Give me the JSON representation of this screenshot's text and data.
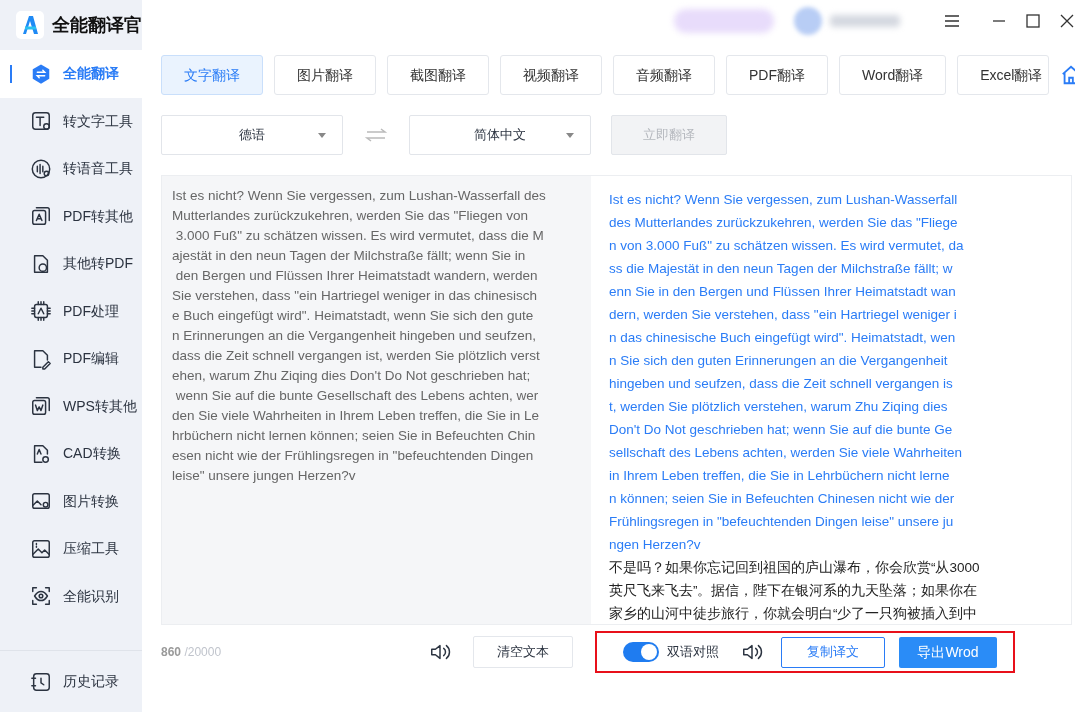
{
  "app": {
    "title": "全能翻译官"
  },
  "sidebar": {
    "items": [
      {
        "label": "全能翻译",
        "selected": true
      },
      {
        "label": "转文字工具",
        "selected": false
      },
      {
        "label": "转语音工具",
        "selected": false
      },
      {
        "label": "PDF转其他",
        "selected": false
      },
      {
        "label": "其他转PDF",
        "selected": false
      },
      {
        "label": "PDF处理",
        "selected": false
      },
      {
        "label": "PDF编辑",
        "selected": false
      },
      {
        "label": "WPS转其他",
        "selected": false
      },
      {
        "label": "CAD转换",
        "selected": false
      },
      {
        "label": "图片转换",
        "selected": false
      },
      {
        "label": "压缩工具",
        "selected": false
      },
      {
        "label": "全能识别",
        "selected": false
      }
    ],
    "footer": {
      "label": "历史记录"
    }
  },
  "tabs": [
    {
      "label": "文字翻译",
      "selected": true
    },
    {
      "label": "图片翻译",
      "selected": false
    },
    {
      "label": "截图翻译",
      "selected": false
    },
    {
      "label": "视频翻译",
      "selected": false
    },
    {
      "label": "音频翻译",
      "selected": false
    },
    {
      "label": "PDF翻译",
      "selected": false
    },
    {
      "label": "Word翻译",
      "selected": false
    },
    {
      "label": "Excel翻译",
      "selected": false
    }
  ],
  "source_language": "德语",
  "target_language": "简体中文",
  "translate_button": {
    "label": "立即翻译",
    "disabled": true
  },
  "source_lines": [
    "Ist es nicht? Wenn Sie vergessen, zum Lushan-Wasserfall des",
    "Mutterlandes zurückzukehren, werden Sie das \"Fliegen von",
    " 3.000 Fuß\" zu schätzen wissen. Es wird vermutet, dass die M",
    "ajestät in den neun Tagen der Milchstraße fällt; wenn Sie in",
    " den Bergen und Flüssen Ihrer Heimatstadt wandern, werden",
    "Sie verstehen, dass \"ein Hartriegel weniger in das chinesisch",
    "e Buch eingefügt wird\". Heimatstadt, wenn Sie sich den gute",
    "n Erinnerungen an die Vergangenheit hingeben und seufzen,",
    "dass die Zeit schnell vergangen ist, werden Sie plötzlich verst",
    "ehen, warum Zhu Ziqing dies Don't Do Not geschrieben hat;",
    " wenn Sie auf die bunte Gesellschaft des Lebens achten, wer",
    "den Sie viele Wahrheiten in Ihrem Leben treffen, die Sie in Le",
    "hrbüchern nicht lernen können; seien Sie in Befeuchten Chin",
    "esen nicht wie der Frühlingsregen in \"befeuchtenden Dingen",
    "leise\" unsere jungen Herzen?v"
  ],
  "result_lines": [
    "Ist es nicht? Wenn Sie vergessen, zum Lushan-Wasserfall",
    "des Mutterlandes zurückzukehren, werden Sie das \"Fliege",
    "n von 3.000 Fuß\" zu schätzen wissen. Es wird vermutet, da",
    "ss die Majestät in den neun Tagen der Milchstraße fällt; w",
    "enn Sie in den Bergen und Flüssen Ihrer Heimatstadt wan",
    "dern, werden Sie verstehen, dass \"ein Hartriegel weniger i",
    "n das chinesische Buch eingefügt wird\". Heimatstadt, wen",
    "n Sie sich den guten Erinnerungen an die Vergangenheit",
    "hingeben und seufzen, dass die Zeit schnell vergangen is",
    "t, werden Sie plötzlich verstehen, warum Zhu Ziqing dies",
    "Don't Do Not geschrieben hat; wenn Sie auf die bunte Ge",
    "sellschaft des Lebens achten, werden Sie viele Wahrheiten",
    "in Ihrem Leben treffen, die Sie in Lehrbüchern nicht lerne",
    "n können; seien Sie in Befeuchten Chinesen nicht wie der",
    "Frühlingsregen in \"befeuchtenden Dingen leise\" unsere ju",
    "ngen Herzen?v"
  ],
  "translated_lines": [
    "不是吗？如果你忘记回到祖国的庐山瀑布，你会欣赏“从3000",
    "英尺飞来飞去”。据信，陛下在银河系的九天坠落；如果你在",
    "家乡的山河中徒步旅行，你就会明白“少了一只狗被插入到中"
  ],
  "char_count": "860",
  "char_limit": "/20000",
  "clear_button": "清空文本",
  "bilingual_toggle": {
    "label": "双语对照",
    "on": true
  },
  "copy_button": "复制译文",
  "export_button": "导出Wrod"
}
